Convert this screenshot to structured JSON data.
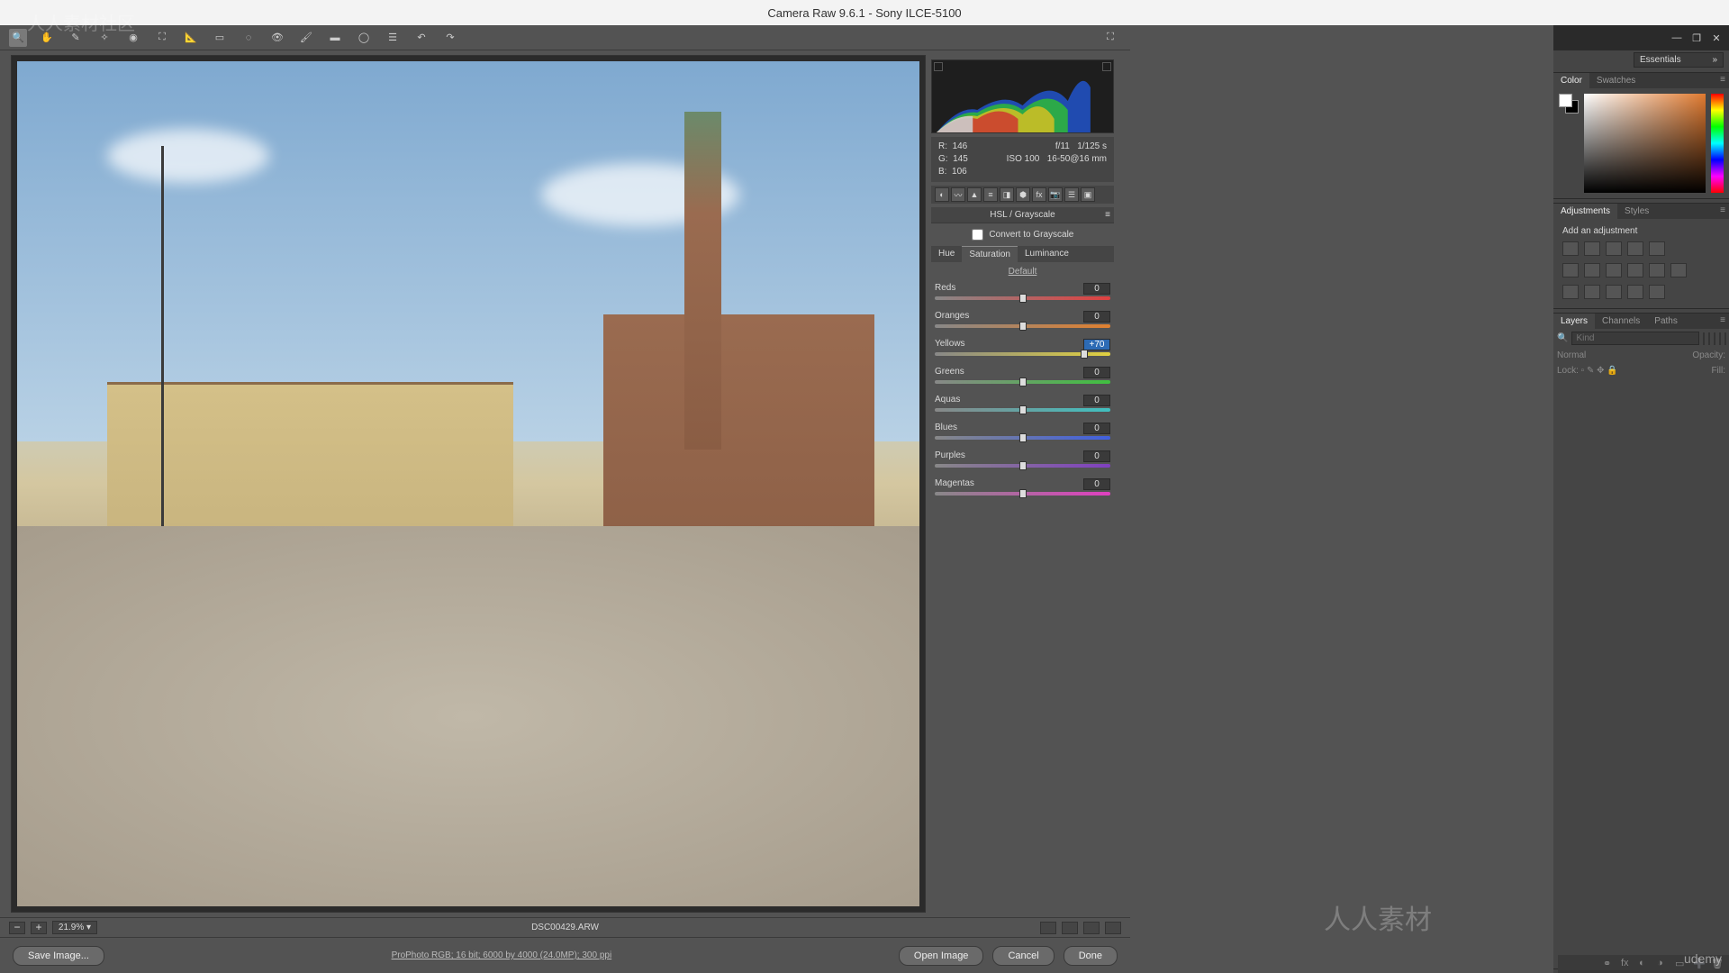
{
  "window": {
    "title": "Camera Raw 9.6.1  -  Sony ILCE-5100"
  },
  "workspace": {
    "selected": "Essentials"
  },
  "camera_raw": {
    "meta": {
      "r_label": "R:",
      "r": "146",
      "g_label": "G:",
      "g": "145",
      "b_label": "B:",
      "b": "106",
      "aperture": "f/11",
      "shutter": "1/125 s",
      "iso": "ISO 100",
      "lens": "16-50@16 mm"
    },
    "panel_title": "HSL / Grayscale",
    "convert_label": "Convert to Grayscale",
    "subtabs": {
      "hue": "Hue",
      "saturation": "Saturation",
      "luminance": "Luminance"
    },
    "default_label": "Default",
    "sliders": [
      {
        "label": "Reds",
        "value": "0",
        "thumb": 50,
        "track": "track-reds"
      },
      {
        "label": "Oranges",
        "value": "0",
        "thumb": 50,
        "track": "track-oranges"
      },
      {
        "label": "Yellows",
        "value": "+70",
        "thumb": 85,
        "track": "track-yellows",
        "highlight": true
      },
      {
        "label": "Greens",
        "value": "0",
        "thumb": 50,
        "track": "track-greens"
      },
      {
        "label": "Aquas",
        "value": "0",
        "thumb": 50,
        "track": "track-aquas"
      },
      {
        "label": "Blues",
        "value": "0",
        "thumb": 50,
        "track": "track-blues"
      },
      {
        "label": "Purples",
        "value": "0",
        "thumb": 50,
        "track": "track-purples"
      },
      {
        "label": "Magentas",
        "value": "0",
        "thumb": 50,
        "track": "track-magentas"
      }
    ],
    "zoom": "21.9%",
    "filename": "DSC00429.ARW",
    "profile_link": "ProPhoto RGB; 16 bit; 6000 by 4000 (24.0MP); 300 ppi",
    "buttons": {
      "save": "Save Image...",
      "open": "Open Image",
      "cancel": "Cancel",
      "done": "Done"
    }
  },
  "ps": {
    "color_tabs": {
      "color": "Color",
      "swatches": "Swatches"
    },
    "adjustments_tabs": {
      "adjustments": "Adjustments",
      "styles": "Styles"
    },
    "add_adjustment": "Add an adjustment",
    "layers_tabs": {
      "layers": "Layers",
      "channels": "Channels",
      "paths": "Paths"
    },
    "layers": {
      "kind_placeholder": "Kind",
      "blend": "Normal",
      "opacity_label": "Opacity:",
      "lock_label": "Lock:",
      "fill_label": "Fill:"
    },
    "search_icon": "🔍"
  },
  "watermarks": {
    "tl": "人人素材社区",
    "br": "人人素材",
    "sm": "udemy"
  }
}
